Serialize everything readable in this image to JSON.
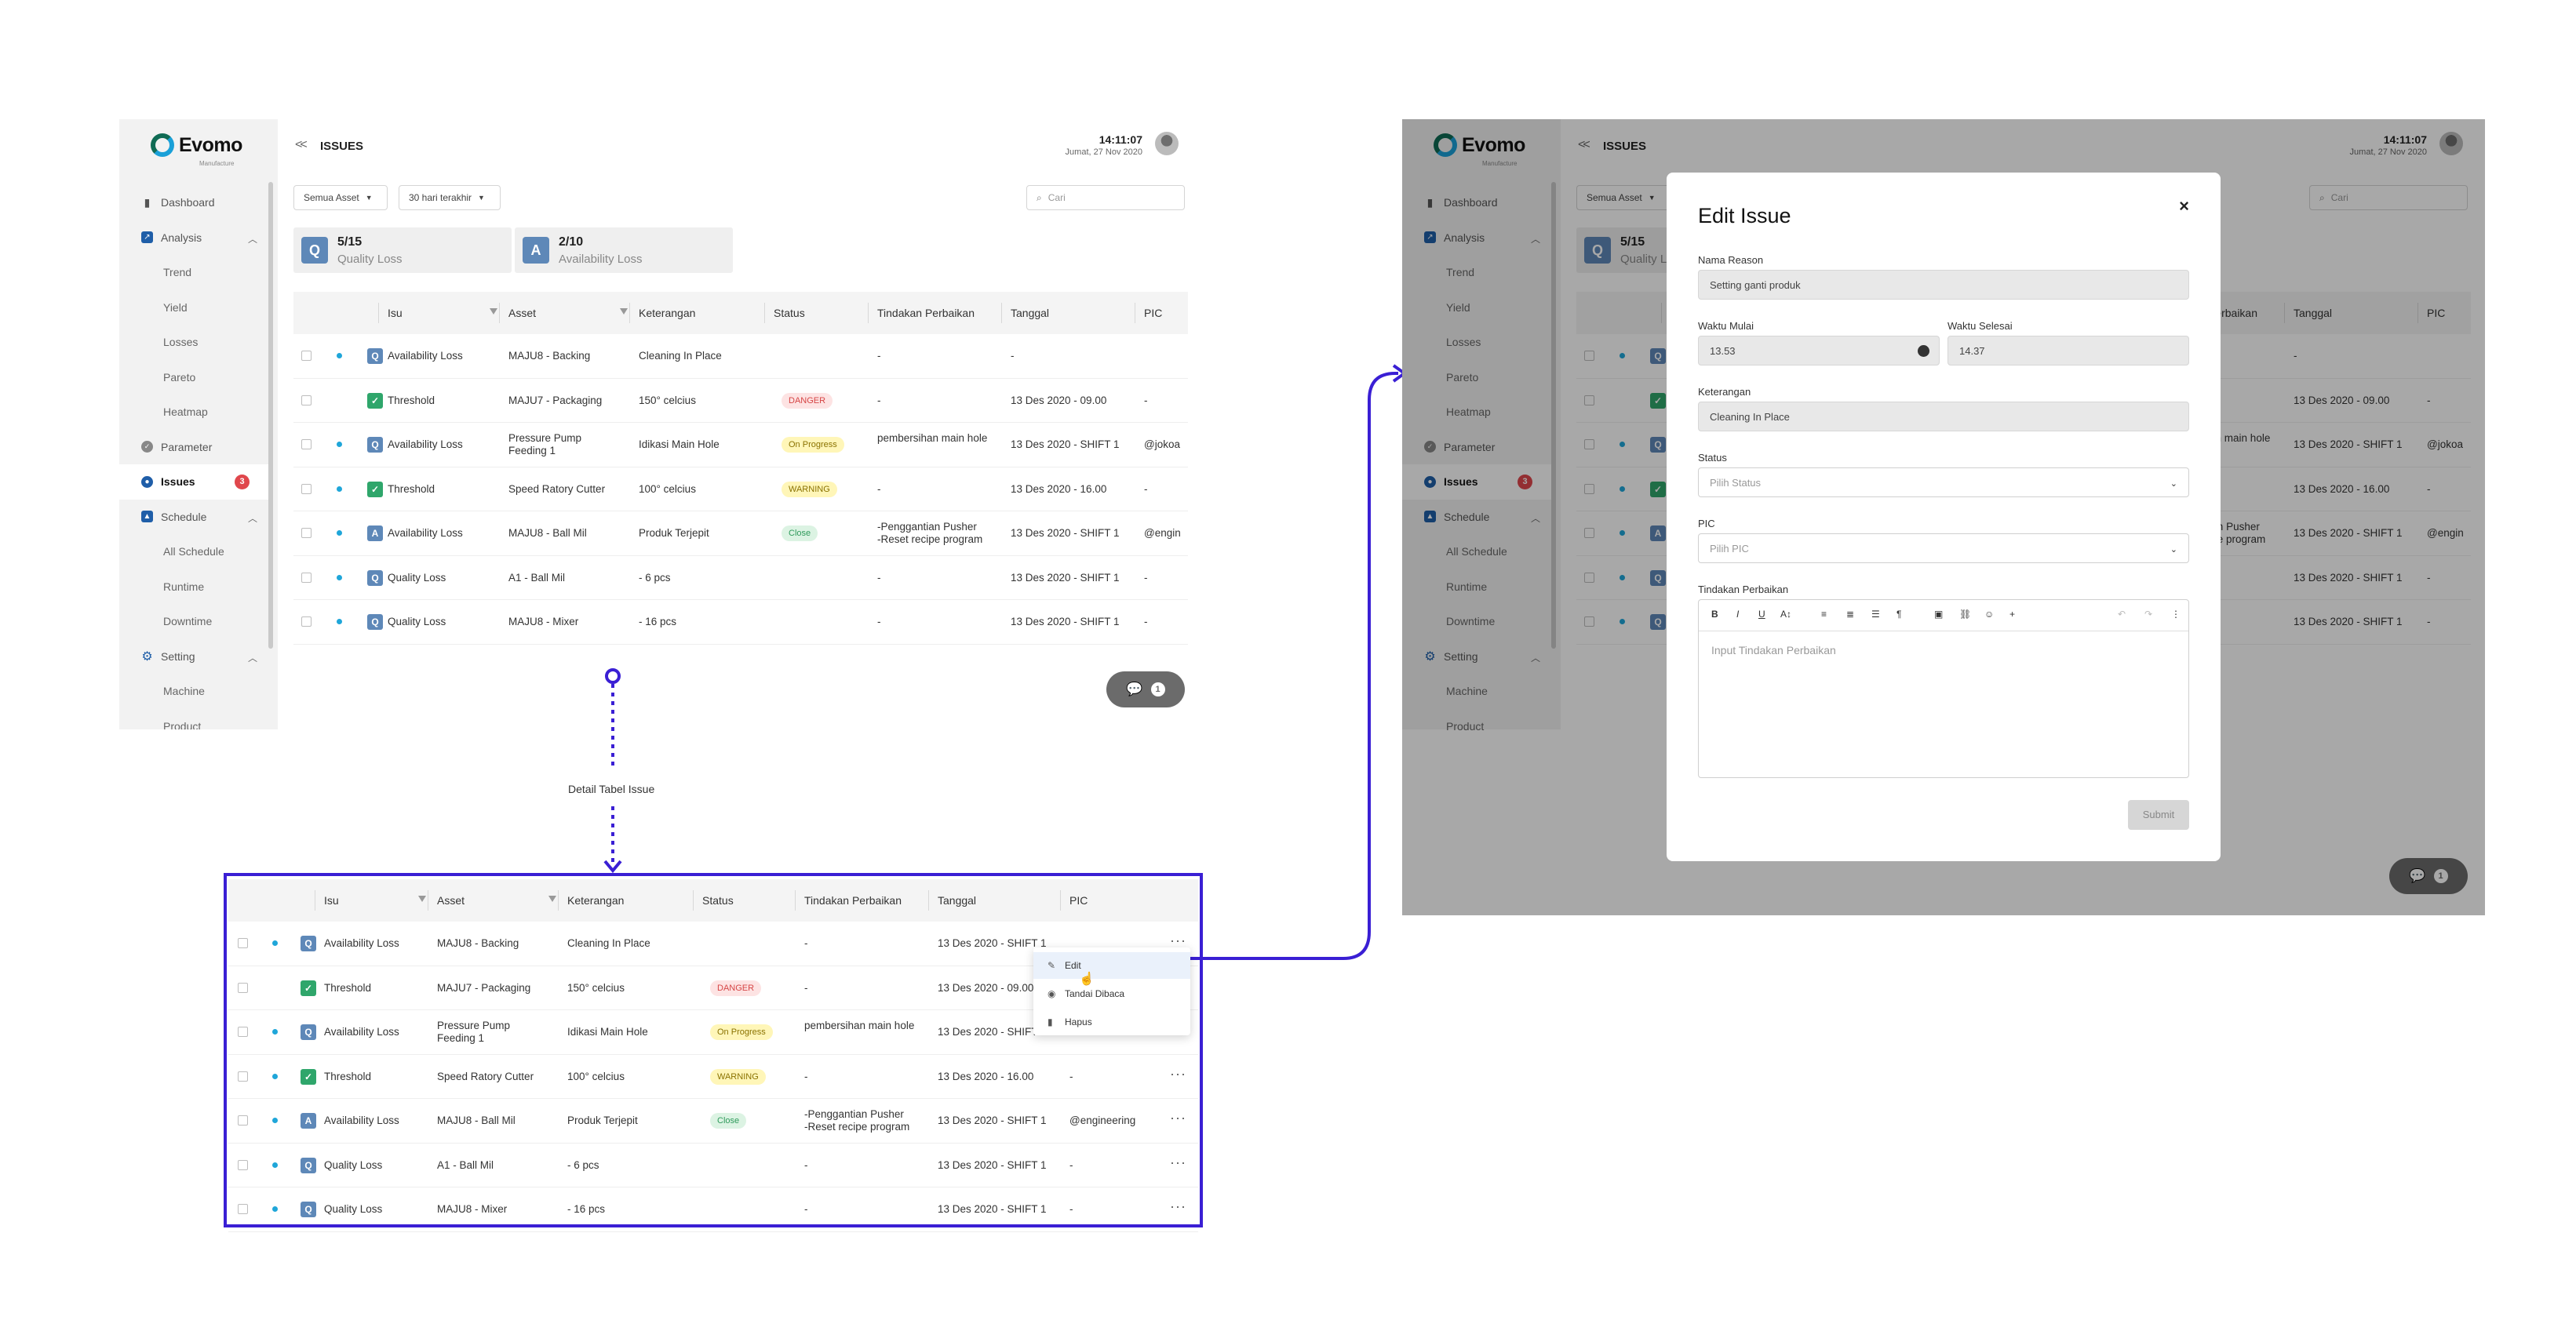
{
  "app": {
    "logo": "Evomo",
    "logo_sub": "Manufacture",
    "page_title": "ISSUES",
    "back_icon": "<<",
    "time": "14:11:07",
    "date": "Jumat, 27 Nov 2020"
  },
  "sidebar": {
    "dashboard": "Dashboard",
    "analysis": "Analysis",
    "trend": "Trend",
    "yield": "Yield",
    "losses": "Losses",
    "pareto": "Pareto",
    "heatmap": "Heatmap",
    "parameter": "Parameter",
    "issues": "Issues",
    "issues_badge": "3",
    "schedule": "Schedule",
    "all_schedule": "All Schedule",
    "runtime": "Runtime",
    "downtime": "Downtime",
    "setting": "Setting",
    "machine": "Machine",
    "product": "Product"
  },
  "filters": {
    "asset": "Semua Asset",
    "range": "30 hari terakhir",
    "search_placeholder": "Cari"
  },
  "stats": {
    "q_icon": "Q",
    "q_value": "5/15",
    "q_label": "Quality Loss",
    "a_icon": "A",
    "a_value": "2/10",
    "a_label": "Availability Loss"
  },
  "table": {
    "headers": {
      "isu": "Isu",
      "asset": "Asset",
      "keterangan": "Keterangan",
      "status": "Status",
      "tindakan": "Tindakan Perbaikan",
      "tanggal": "Tanggal",
      "pic": "PIC"
    },
    "rows": [
      {
        "icon": "Q",
        "isu": "Availability Loss",
        "asset": "MAJU8 - Backing",
        "ket": "Cleaning In Place",
        "status": "",
        "tindakan": "-",
        "tanggal_main": "-",
        "tanggal_detail": "13 Des 2020 - SHIFT 1",
        "pic_main": "",
        "pic_detail": ""
      },
      {
        "icon": "T",
        "isu": "Threshold",
        "asset": "MAJU7 - Packaging",
        "ket": "150° celcius",
        "status": "DANGER",
        "tindakan": "-",
        "tanggal_main": "13 Des 2020 - 09.00",
        "tanggal_detail": "13 Des 2020 - 09.00",
        "pic_main": "-",
        "pic_detail": ""
      },
      {
        "icon": "Q",
        "isu": "Availability Loss",
        "asset": "Pressure Pump Feeding 1",
        "ket": "Idikasi Main Hole",
        "status": "On Progress",
        "tindakan": "pembersihan main hole",
        "tanggal_main": "13 Des 2020 - SHIFT 1",
        "tanggal_detail": "13 Des 2020 - SHIFT 1",
        "pic_main": "@jokoa",
        "pic_detail": ""
      },
      {
        "icon": "T",
        "isu": "Threshold",
        "asset": "Speed Ratory Cutter",
        "ket": "100° celcius",
        "status": "WARNING",
        "tindakan": "-",
        "tanggal_main": "13 Des 2020 - 16.00",
        "tanggal_detail": "13 Des 2020 - 16.00",
        "pic_main": "-",
        "pic_detail": "-"
      },
      {
        "icon": "A",
        "isu": "Availability Loss",
        "asset": "MAJU8 - Ball Mil",
        "ket": "Produk Terjepit",
        "status": "Close",
        "tindakan": "-Penggantian Pusher\n-Reset recipe program",
        "tanggal_main": "13 Des 2020 - SHIFT 1",
        "tanggal_detail": "13 Des 2020 - SHIFT 1",
        "pic_main": "@engin",
        "pic_detail": "@engineering"
      },
      {
        "icon": "Q",
        "isu": "Quality Loss",
        "asset": "A1 - Ball Mil",
        "ket": "- 6 pcs",
        "status": "",
        "tindakan": "-",
        "tanggal_main": "13 Des 2020 - SHIFT 1",
        "tanggal_detail": "13 Des 2020 - SHIFT 1",
        "pic_main": "-",
        "pic_detail": "-"
      },
      {
        "icon": "Q",
        "isu": "Quality Loss",
        "asset": "MAJU8 - Mixer",
        "ket": "- 16 pcs",
        "status": "",
        "tindakan": "-",
        "tanggal_main": "13 Des 2020 - SHIFT 1",
        "tanggal_detail": "13 Des 2020 - SHIFT 1",
        "pic_main": "-",
        "pic_detail": "-"
      }
    ]
  },
  "fab": {
    "count": "1"
  },
  "annotation": {
    "detail_label": "Detail Tabel Issue"
  },
  "context_menu": {
    "edit": "Edit",
    "mark_read": "Tandai Dibaca",
    "delete": "Hapus"
  },
  "modal": {
    "title": "Edit Issue",
    "close": "×",
    "nama_reason_label": "Nama Reason",
    "nama_reason_value": "Setting ganti produk",
    "waktu_mulai_label": "Waktu Mulai",
    "waktu_mulai_value": "13.53",
    "waktu_selesai_label": "Waktu Selesai",
    "waktu_selesai_value": "14.37",
    "keterangan_label": "Keterangan",
    "keterangan_value": "Cleaning In Place",
    "status_label": "Status",
    "status_placeholder": "Pilih Status",
    "pic_label": "PIC",
    "pic_placeholder": "Pilih PIC",
    "tindakan_label": "Tindakan Perbaikan",
    "tindakan_placeholder": "Input Tindakan Perbaikan",
    "submit": "Submit"
  },
  "colors": {
    "accent_frame": "#3a1fd4",
    "danger": "#d64545",
    "success": "#2f9a5b",
    "info_dot": "#1fa6d9"
  }
}
